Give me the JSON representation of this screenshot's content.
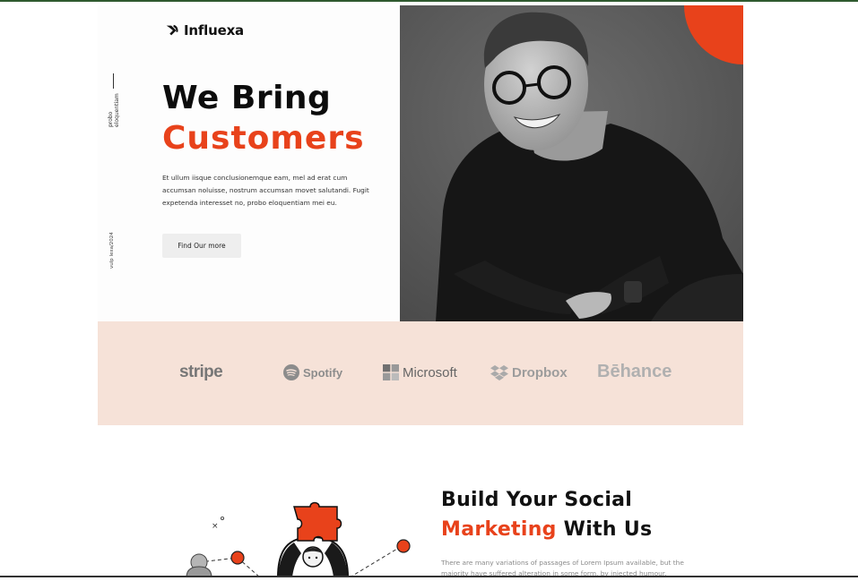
{
  "brand": {
    "name": "Influexa"
  },
  "hero": {
    "headline_line1": "We Bring",
    "headline_line2": "Customers",
    "description": "Et ullum iisque conclusionemque eam, mel ad erat cum accumsan noluisse, nostrum accumsan movet salutandi. Fugit expetenda interesset no, probo eloquentiam mei eu.",
    "cta_label": "Find Our more",
    "side_text_top": "probo eloquentiam",
    "side_text_bottom": "vulp lexa/2024"
  },
  "partners": [
    "stripe",
    "Spotify",
    "Microsoft",
    "Dropbox",
    "Bēhance"
  ],
  "section": {
    "title_line1": "Build Your Social",
    "title_accent": "Marketing",
    "title_rest": " With Us",
    "description": "There are many variations of passages of Lorem Ipsum available, but the majority have suffered alteration in some form, by injected humour."
  },
  "colors": {
    "accent": "#e8421b",
    "band": "#f6e2d8"
  }
}
